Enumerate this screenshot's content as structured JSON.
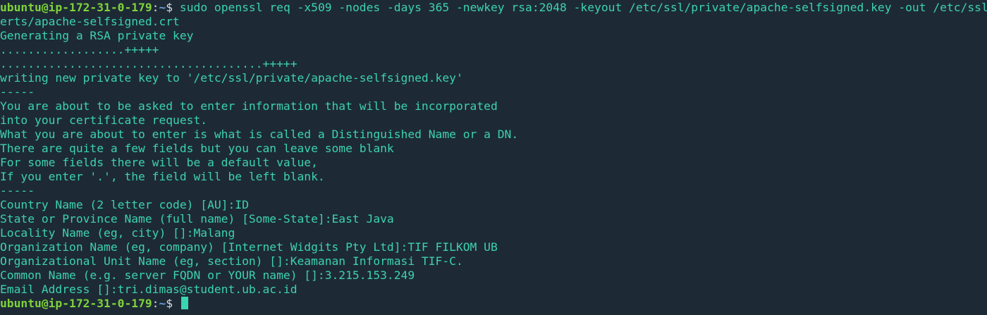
{
  "prompt": {
    "user_host": "ubuntu@ip-172-31-0-179",
    "separator": ":",
    "path": "~",
    "symbol": "$"
  },
  "command": {
    "line1": "sudo openssl req -x509 -nodes -days 365 -newkey rsa:2048 -keyout /etc/ssl/private/apache-selfsigned.key -out /etc/ssl/c",
    "line2": "erts/apache-selfsigned.crt"
  },
  "output": [
    "Generating a RSA private key",
    "..................+++++",
    "......................................+++++",
    "writing new private key to '/etc/ssl/private/apache-selfsigned.key'",
    "-----",
    "You are about to be asked to enter information that will be incorporated",
    "into your certificate request.",
    "What you are about to enter is what is called a Distinguished Name or a DN.",
    "There are quite a few fields but you can leave some blank",
    "For some fields there will be a default value,",
    "If you enter '.', the field will be left blank.",
    "-----",
    "Country Name (2 letter code) [AU]:ID",
    "State or Province Name (full name) [Some-State]:East Java",
    "Locality Name (eg, city) []:Malang",
    "Organization Name (eg, company) [Internet Widgits Pty Ltd]:TIF FILKOM UB",
    "Organizational Unit Name (eg, section) []:Keamanan Informasi TIF-C.",
    "Common Name (e.g. server FQDN or YOUR name) []:3.215.153.249",
    "Email Address []:tri.dimas@student.ub.ac.id"
  ],
  "colors": {
    "background": "#1d2a35",
    "text": "#3dd1b1",
    "user_host": "#7fd33b",
    "path": "#6f9ad8",
    "cursor": "#39d5b0"
  }
}
